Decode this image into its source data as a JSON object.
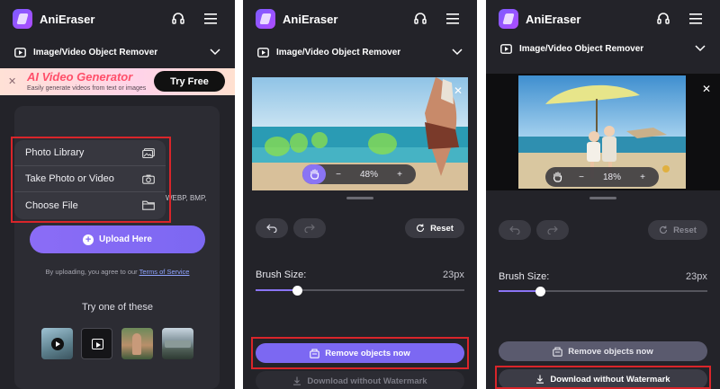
{
  "app": {
    "name": "AniEraser"
  },
  "tool_selector": {
    "label": "Image/Video Object Remover"
  },
  "panel1": {
    "banner": {
      "title": "AI Video Generator",
      "subtitle": "Easily generate videos from text or images",
      "button": "Try Free"
    },
    "menu": [
      {
        "label": "Photo Library",
        "icon": "photo-library-icon"
      },
      {
        "label": "Take Photo or Video",
        "icon": "camera-icon"
      },
      {
        "label": "Choose File",
        "icon": "folder-icon"
      }
    ],
    "formats_text": "WEBP, BMP,",
    "upload_label": "Upload Here",
    "terms_prefix": "By uploading, you agree to our",
    "terms_link": "Terms of Service",
    "try_one_label": "Try one of these"
  },
  "panel2": {
    "zoom": "48%",
    "reset_label": "Reset",
    "brush_label": "Brush Size:",
    "brush_value": "23px",
    "brush_level": 0.2,
    "remove_label": "Remove objects now",
    "download_label": "Download without Watermark"
  },
  "panel3": {
    "zoom": "18%",
    "reset_label": "Reset",
    "brush_label": "Brush Size:",
    "brush_value": "23px",
    "brush_level": 0.2,
    "remove_label": "Remove objects now",
    "download_label": "Download without Watermark"
  },
  "colors": {
    "accent": "#7c68f2",
    "highlight": "#d9252a",
    "panel_bg": "#232329"
  }
}
